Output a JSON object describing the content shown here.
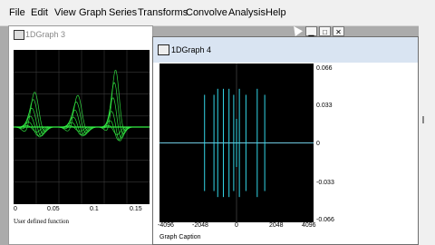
{
  "menu": [
    "File",
    "Edit",
    "View",
    "Graph",
    "Series",
    "Transforms",
    "Convolve",
    "Analysis",
    "Help"
  ],
  "window3": {
    "title": "1DGraph 3",
    "x_ticks": [
      "0",
      "0.05",
      "0.1",
      "0.15"
    ],
    "caption": "User defined function"
  },
  "window4": {
    "title": "1DGraph 4",
    "y_ticks": [
      "0.066",
      "0.033",
      "0",
      "-0.033",
      "-0.066"
    ],
    "x_ticks": [
      "-4096",
      "-2048",
      "0",
      "2048",
      "4096"
    ],
    "caption": "Graph Caption",
    "buttons": [
      "minimize",
      "maximize",
      "close"
    ]
  },
  "colors": {
    "plot_bg": "#000000",
    "trace3": "#33ee44",
    "trace4": "#33d7e8"
  },
  "chart_data": [
    {
      "type": "line",
      "title": "1DGraph 3",
      "xlabel": "User defined function",
      "xlim": [
        0,
        0.18
      ],
      "series_note": "overlaid damped gaussian pulses centered near 0.028, 0.085, 0.135",
      "series": [
        {
          "x": [
            0.028,
            0.085,
            0.135
          ],
          "values": [
            0.55,
            0.5,
            0.9
          ]
        }
      ]
    },
    {
      "type": "line",
      "title": "1DGraph 4",
      "xlabel": "Graph Caption",
      "xlim": [
        -4096,
        4096
      ],
      "ylim": [
        -0.066,
        0.066
      ],
      "series": [
        {
          "x": [
            -1700,
            -1200,
            -1000,
            -700,
            -400,
            -150,
            0,
            150,
            500,
            1100,
            1500
          ],
          "values": [
            0.04,
            -0.04,
            0.045,
            0.045,
            -0.045,
            0.04,
            0.02,
            -0.045,
            0.04,
            0.045,
            0.04
          ]
        }
      ]
    }
  ]
}
